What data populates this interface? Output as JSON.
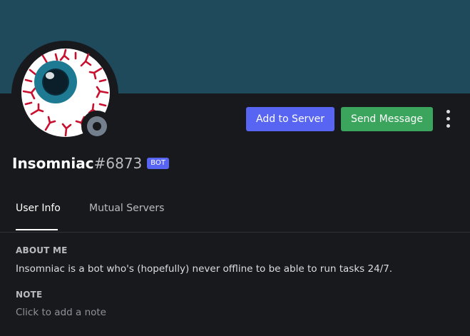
{
  "profile": {
    "username": "Insomniac",
    "discriminator": "#6873",
    "bot_tag": "BOT",
    "status": "offline"
  },
  "actions": {
    "add_to_server": "Add to Server",
    "send_message": "Send Message",
    "more_icon": "more-vertical-icon"
  },
  "tabs": [
    {
      "label": "User Info",
      "active": true
    },
    {
      "label": "Mutual Servers",
      "active": false
    }
  ],
  "about_me": {
    "heading": "ABOUT ME",
    "text": "Insomniac is a bot who's (hopefully) never offline to be able to run tasks 24/7."
  },
  "note": {
    "heading": "NOTE",
    "placeholder": "Click to add a note"
  },
  "colors": {
    "banner": "#1e4a5c",
    "background": "#18191c",
    "blurple": "#5865f2",
    "green": "#3ba55d",
    "status_offline": "#747f8d"
  }
}
